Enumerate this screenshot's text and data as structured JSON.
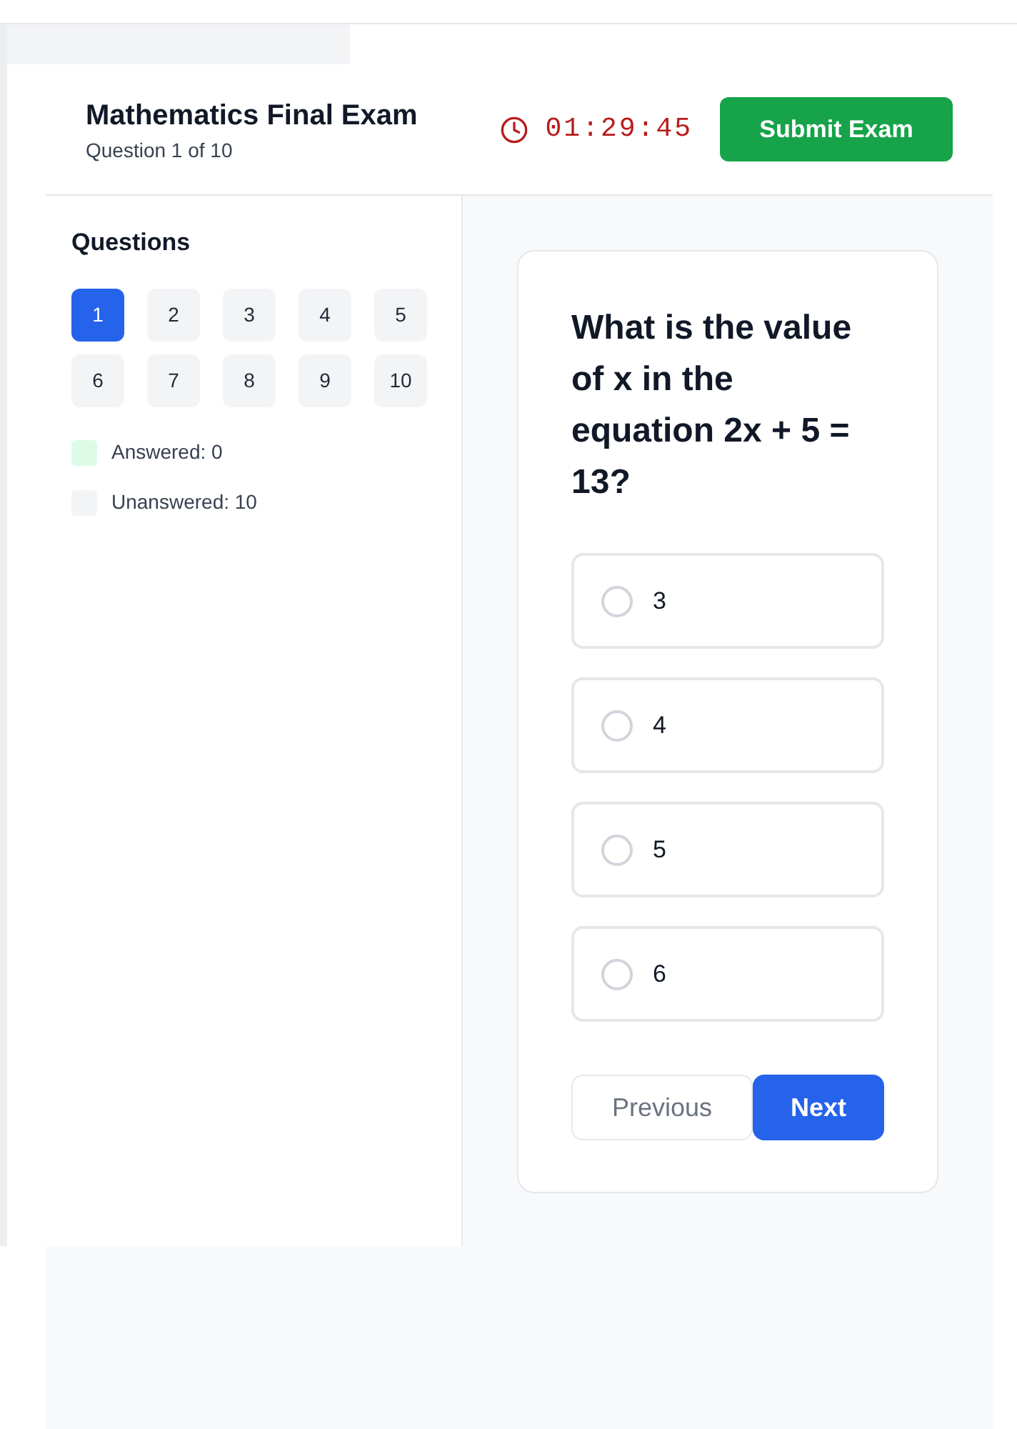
{
  "header": {
    "title": "Mathematics Final Exam",
    "subtitle": "Question 1 of 10",
    "timer": "01:29:45",
    "submit_button": "Submit Exam"
  },
  "sidebar": {
    "title": "Questions",
    "questions": [
      {
        "label": "1",
        "selected": true,
        "answered": false
      },
      {
        "label": "2",
        "selected": false,
        "answered": false
      },
      {
        "label": "3",
        "selected": false,
        "answered": false
      },
      {
        "label": "4",
        "selected": false,
        "answered": false
      },
      {
        "label": "5",
        "selected": false,
        "answered": false
      },
      {
        "label": "6",
        "selected": false,
        "answered": false
      },
      {
        "label": "7",
        "selected": false,
        "answered": false
      },
      {
        "label": "8",
        "selected": false,
        "answered": false
      },
      {
        "label": "9",
        "selected": false,
        "answered": false
      },
      {
        "label": "10",
        "selected": false,
        "answered": false
      }
    ],
    "legend": [
      {
        "label": "Answered: 0",
        "color": "#dcfce7"
      },
      {
        "label": "Unanswered: 10",
        "color": "#f3f4f6"
      }
    ]
  },
  "question": {
    "text": "What is the value of x in the equation 2x + 5 = 13?",
    "options": [
      {
        "label": "3",
        "selected": false
      },
      {
        "label": "4",
        "selected": false
      },
      {
        "label": "5",
        "selected": false
      },
      {
        "label": "6",
        "selected": false
      }
    ]
  },
  "navigation": {
    "previous": {
      "label": "Previous",
      "disabled": true
    },
    "next": {
      "label": "Next",
      "disabled": false
    }
  }
}
